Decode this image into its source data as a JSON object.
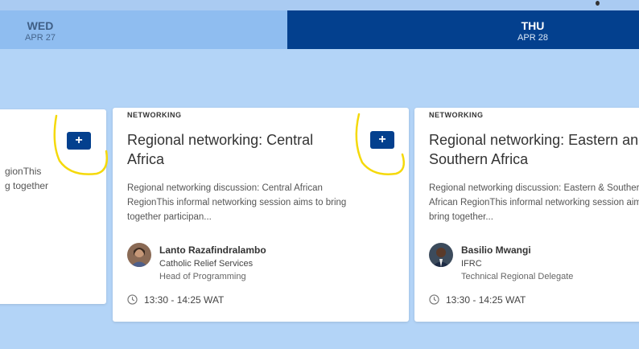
{
  "days": [
    {
      "name": "WED",
      "date": "APR 27"
    },
    {
      "name": "THU",
      "date": "APR 28"
    }
  ],
  "cards": [
    {
      "partial_desc": "gionThis\ng together"
    },
    {
      "tag": "NETWORKING",
      "title": "Regional networking: Central Africa",
      "desc": "Regional networking discussion: Central African RegionThis informal networking session aims to bring together participan...",
      "speaker": {
        "name": "Lanto Razafindralambo",
        "org": "Catholic Relief Services",
        "role": "Head of Programming"
      },
      "time": "13:30 - 14:25 WAT"
    },
    {
      "tag": "NETWORKING",
      "title": "Regional networking: Eastern and Southern Africa",
      "desc": "Regional networking discussion: Eastern & Southern African RegionThis informal networking session aims to bring together...",
      "speaker": {
        "name": "Basilio Mwangi",
        "org": "IFRC",
        "role": "Technical Regional Delegate"
      },
      "time": "13:30 - 14:25 WAT"
    }
  ],
  "add_label": "+",
  "icons": {
    "add": "plus-icon",
    "clock": "clock-icon",
    "highlight": "yellow-circle-annotation"
  },
  "colors": {
    "header_active": "#03408e",
    "header_inactive": "#8fbdf0",
    "background": "#b3d4f7",
    "annotation": "#f5d90a"
  }
}
